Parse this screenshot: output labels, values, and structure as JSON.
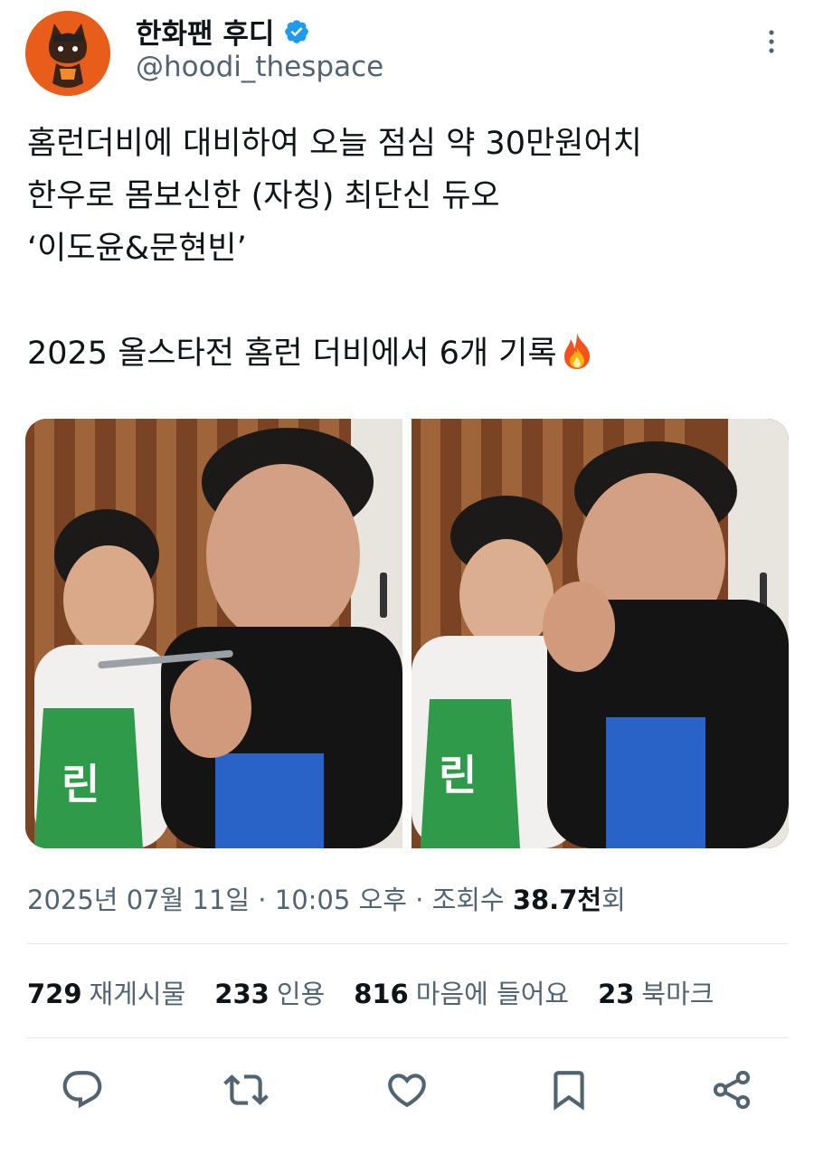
{
  "author": {
    "display_name": "한화팬 후디",
    "handle": "@hoodi_thespace",
    "verified_icon": "verified-badge-icon",
    "avatar_color": "#e85d1a"
  },
  "tweet": {
    "lines": [
      "홈런더비에 대비하여 오늘 점심 약 30만원어치",
      "한우로 몸보신한 (자칭) 최단신 듀오",
      "‘이도윤&문현빈’",
      "",
      "2025 올스타전 홈런 더비에서 6개 기록"
    ],
    "emoji": "fire-emoji"
  },
  "meta": {
    "date": "2025년 07월 11일",
    "sep1": " · ",
    "time": "10:05 오후",
    "sep2": " · ",
    "views_label": "조회수 ",
    "views_value": "38.7천",
    "views_suffix": "회"
  },
  "stats": {
    "reposts": {
      "num": "729",
      "label": "재게시물"
    },
    "quotes": {
      "num": "233",
      "label": "인용"
    },
    "likes": {
      "num": "816",
      "label": "마음에 들어요"
    },
    "bookmarks": {
      "num": "23",
      "label": "북마크"
    }
  },
  "actions": [
    "reply-icon",
    "repost-icon",
    "like-icon",
    "bookmark-icon",
    "share-icon"
  ],
  "colors": {
    "text": "#0f1419",
    "secondary": "#536471",
    "verified": "#1d9bf0",
    "divider": "#e1e6ea"
  }
}
